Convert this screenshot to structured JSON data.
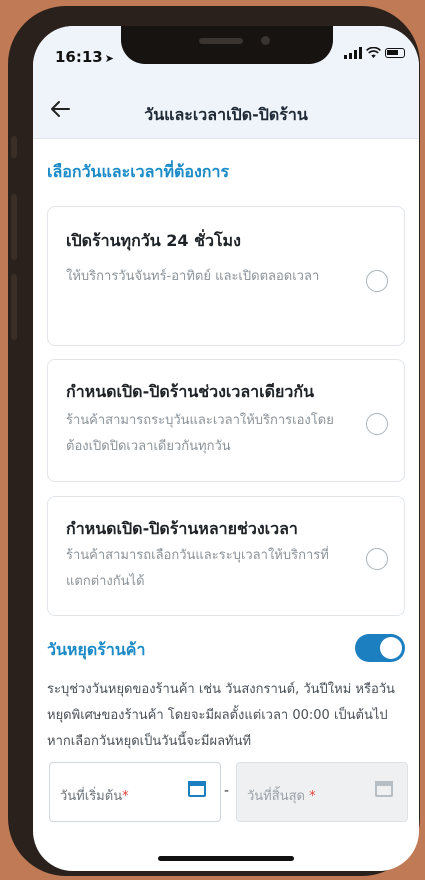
{
  "status": {
    "time": "16:13"
  },
  "nav": {
    "title": "วันและเวลาเปิด-ปิดร้าน"
  },
  "section": {
    "title": "เลือกวันและเวลาที่ต้องการ"
  },
  "options": [
    {
      "title": "เปิดร้านทุกวัน 24 ชั่วโมง",
      "desc": "ให้บริการวันจันทร์-อาทิตย์ และเปิดตลอดเวลา",
      "selected": false
    },
    {
      "title": "กำหนดเปิด-ปิดร้านช่วงเวลาเดียวกัน",
      "desc": "ร้านค้าสามารถระบุวันและเวลาให้บริการเองโดยต้องเปิดปิดเวลาเดียวกันทุกวัน",
      "selected": false
    },
    {
      "title": "กำหนดเปิด-ปิดร้านหลายช่วงเวลา",
      "desc": "ร้านค้าสามารถเลือกวันและระบุเวลาให้บริการที่แตกต่างกันได้",
      "selected": false
    }
  ],
  "holiday": {
    "title": "วันหยุดร้านค้า",
    "enabled": true,
    "desc": "ระบุช่วงวันหยุดของร้านค้า เช่น วันสงกรานต์, วันปีใหม่ หรือวันหยุดพิเศษของร้านค้า โดยจะมีผลตั้งแต่เวลา 00:00 เป็นต้นไป หากเลือกวันหยุดเป็นวันนี้จะมีผลทันที",
    "start_label": "วันที่เริ่มต้น",
    "end_label": "วันที่สิ้นสุด",
    "required_mark": "*",
    "separator": "-"
  },
  "colors": {
    "accent": "#1b8bc7",
    "toggle": "#1b7fc0",
    "background": "#c07a55"
  },
  "icons": {
    "back": "arrow-left-icon",
    "calendar": "calendar-icon"
  }
}
